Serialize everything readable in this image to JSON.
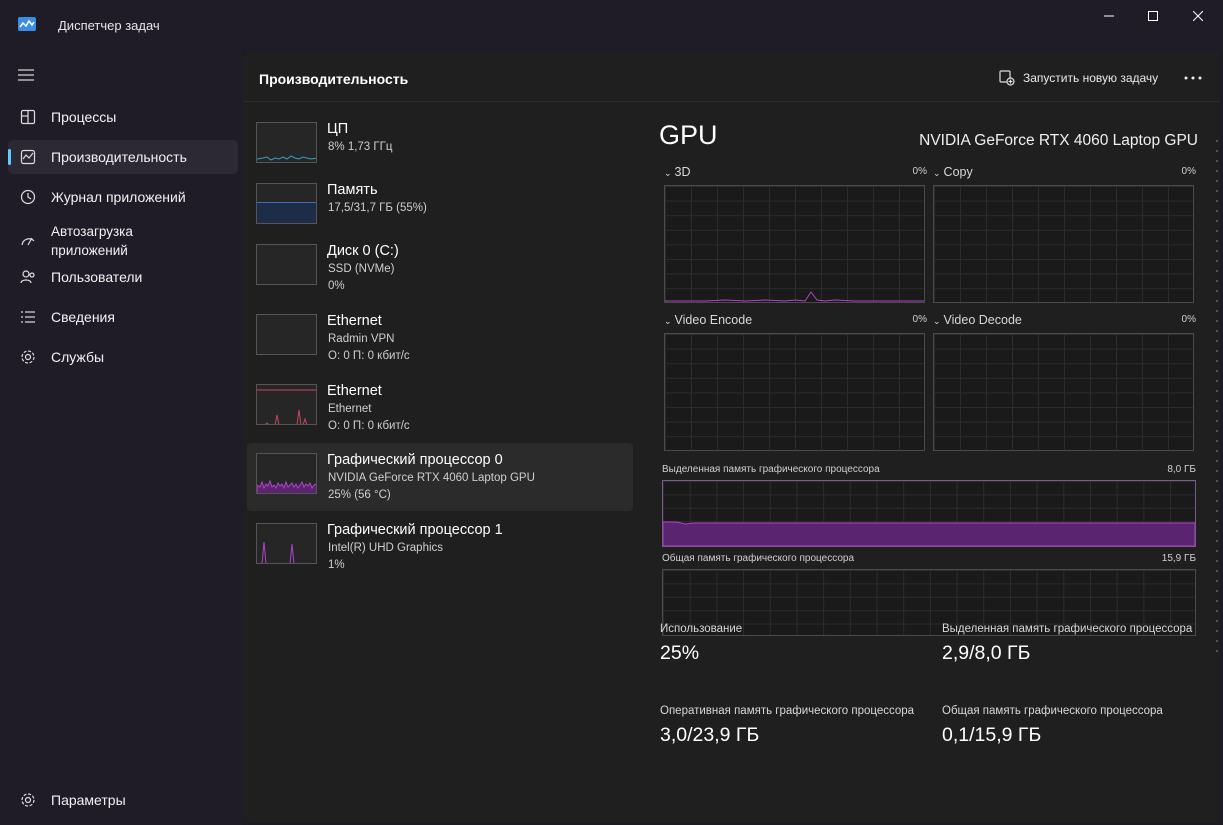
{
  "window": {
    "title": "Диспетчер задач"
  },
  "sidebar": {
    "items": [
      {
        "label": "Процессы",
        "icon": "processes-icon"
      },
      {
        "label": "Производительность",
        "icon": "performance-icon",
        "active": true
      },
      {
        "label": "Журнал приложений",
        "icon": "history-icon"
      },
      {
        "label": "Автозагрузка\nприложений",
        "icon": "startup-icon"
      },
      {
        "label": "Пользователи",
        "icon": "users-icon"
      },
      {
        "label": "Сведения",
        "icon": "details-icon"
      },
      {
        "label": "Службы",
        "icon": "services-icon"
      }
    ],
    "settings_label": "Параметры"
  },
  "header": {
    "title": "Производительность",
    "run_task_label": "Запустить новую задачу",
    "more_icon": "ellipsis-icon"
  },
  "devices": [
    {
      "name": "ЦП",
      "sub1": "8%  1,73 ГГц",
      "sub2": ""
    },
    {
      "name": "Память",
      "sub1": "17,5/31,7 ГБ (55%)",
      "sub2": ""
    },
    {
      "name": "Диск 0 (C:)",
      "sub1": "SSD (NVMe)",
      "sub2": "0%"
    },
    {
      "name": "Ethernet",
      "sub1": "Radmin VPN",
      "sub2": "О: 0  П: 0 кбит/с"
    },
    {
      "name": "Ethernet",
      "sub1": "Ethernet",
      "sub2": "О: 0  П: 0 кбит/с"
    },
    {
      "name": "Графический процессор 0",
      "sub1": "NVIDIA GeForce RTX 4060 Laptop GPU",
      "sub2": "25%  (56 °C)",
      "selected": true
    },
    {
      "name": "Графический процессор 1",
      "sub1": "Intel(R) UHD Graphics",
      "sub2": "1%"
    }
  ],
  "gpu": {
    "title": "GPU",
    "model": "NVIDIA GeForce RTX 4060 Laptop GPU",
    "engines": [
      {
        "label": "3D",
        "pct": "0%"
      },
      {
        "label": "Copy",
        "pct": "0%"
      },
      {
        "label": "Video Encode",
        "pct": "0%"
      },
      {
        "label": "Video Decode",
        "pct": "0%"
      }
    ],
    "dedicated_mem_label": "Выделенная память графического процессора",
    "dedicated_mem_max": "8,0 ГБ",
    "shared_mem_label": "Общая память графического процессора",
    "shared_mem_max": "15,9 ГБ",
    "stats": {
      "usage_label": "Использование",
      "usage_value": "25%",
      "dedicated_label": "Выделенная память графического процессора",
      "dedicated_value": "2,9/8,0 ГБ",
      "ram_label": "Оперативная память графического процессора",
      "ram_value": "3,0/23,9 ГБ",
      "shared_label": "Общая память графического процессора",
      "shared_value": "0,1/15,9 ГБ"
    }
  },
  "colors": {
    "accent": "#60cdff",
    "gpu_series": "#b044c8",
    "memory_series": "#3f6fb0",
    "cpu_series": "#2fa3c4",
    "ethernet_series": "#c8485e"
  }
}
